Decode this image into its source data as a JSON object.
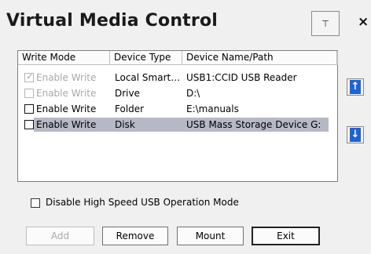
{
  "window": {
    "title": "Virtual Media Control",
    "pin_label": "⊤",
    "close_label": "×"
  },
  "device_list": {
    "columns": [
      "Write Mode",
      "Device Type",
      "Device Name/Path"
    ],
    "rows": [
      {
        "write_label": "Enable Write",
        "checked": true,
        "enabled": false,
        "type": "Local Smart…",
        "name": "USB1:CCID USB Reader",
        "selected": false
      },
      {
        "write_label": "Enable Write",
        "checked": false,
        "enabled": false,
        "type": "Drive",
        "name": "D:\\",
        "selected": false
      },
      {
        "write_label": "Enable Write",
        "checked": false,
        "enabled": true,
        "type": "Folder",
        "name": "E:\\manuals",
        "selected": false
      },
      {
        "write_label": "Enable Write",
        "checked": false,
        "enabled": true,
        "type": "Disk",
        "name": "USB Mass Storage Device G:",
        "selected": true
      }
    ]
  },
  "side_buttons": {
    "up_icon": "up-arrow-icon",
    "down_icon": "down-arrow-icon",
    "up_glyph": "↑",
    "down_glyph": "↓"
  },
  "high_speed": {
    "label": "Disable High Speed USB Operation Mode",
    "checked": false
  },
  "buttons": {
    "add": "Add",
    "remove": "Remove",
    "mount": "Mount",
    "exit": "Exit"
  },
  "colors": {
    "selection": "#b5b9c5",
    "arrow_blue": "#1f63d6"
  }
}
